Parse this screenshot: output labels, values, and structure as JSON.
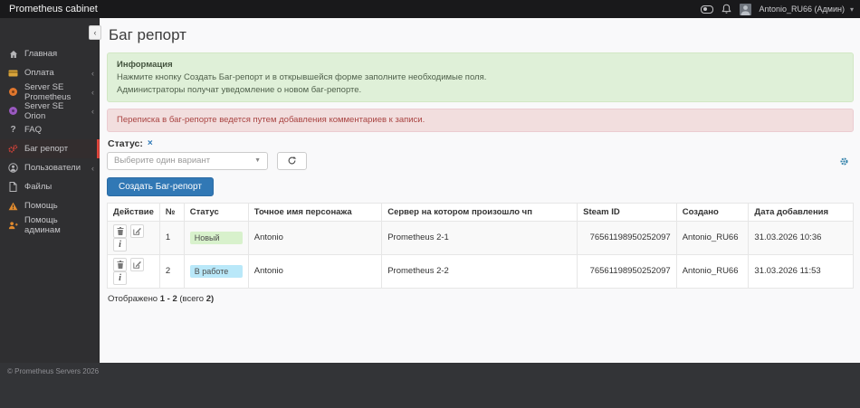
{
  "navbar": {
    "brand": "Prometheus cabinet",
    "user_name": "Antonio_RU66 (Админ)",
    "caret": "▾"
  },
  "sidebar": {
    "items": [
      {
        "label": "Главная"
      },
      {
        "label": "Оплата"
      },
      {
        "label": "Server SE Prometheus"
      },
      {
        "label": "Server SE Orion"
      },
      {
        "label": "FAQ"
      },
      {
        "label": "Баг репорт"
      },
      {
        "label": "Пользователи"
      },
      {
        "label": "Файлы"
      },
      {
        "label": "Помощь"
      },
      {
        "label": "Помощь админам"
      }
    ],
    "chevron": "‹",
    "question_glyph": "?"
  },
  "footer": {
    "copyright": "© Prometheus Servers 2026"
  },
  "main": {
    "collapse": "‹",
    "title": "Баг репорт",
    "info_alert": {
      "title": "Информация",
      "line1": "Нажмите кнопку Создать Баг-репорт и в открывшейся форме заполните необходимые поля.",
      "line2": "Администраторы получат уведомление о новом баг-репорте."
    },
    "warning_alert": "Переписка в баг-репорте ведется путем добавления комментариев к записи.",
    "filter": {
      "label": "Статус:",
      "clear": "×",
      "placeholder": "Выберите один вариант",
      "caret": "▼"
    },
    "create_button": "Создать Баг-репорт",
    "table": {
      "headers": [
        "Действие",
        "№",
        "Статус",
        "Точное имя персонажа",
        "Сервер на котором произошло чп",
        "Steam ID",
        "Создано",
        "Дата добавления"
      ],
      "rows": [
        {
          "num": "1",
          "status": "Новый",
          "name": "Antonio",
          "server": "Prometheus 2-1",
          "steam_id": "76561198950252097",
          "created_by": "Antonio_RU66",
          "date": "31.03.2026 10:36"
        },
        {
          "num": "2",
          "status": "В работе",
          "name": "Antonio",
          "server": "Prometheus 2-2",
          "steam_id": "76561198950252097",
          "created_by": "Antonio_RU66",
          "date": "31.03.2026 11:53"
        }
      ]
    },
    "summary": {
      "prefix": "Отображено",
      "range": "1 - 2",
      "total_label": "(всего",
      "total": "2)"
    }
  },
  "colors": {
    "accent_blue": "#3178b5",
    "active_red": "#e0443a",
    "status_new_bg": "#d8f1cc",
    "status_progress_bg": "#b9e8f9",
    "alert_success_bg": "#dff0d8",
    "alert_danger_bg": "#f2dede"
  }
}
